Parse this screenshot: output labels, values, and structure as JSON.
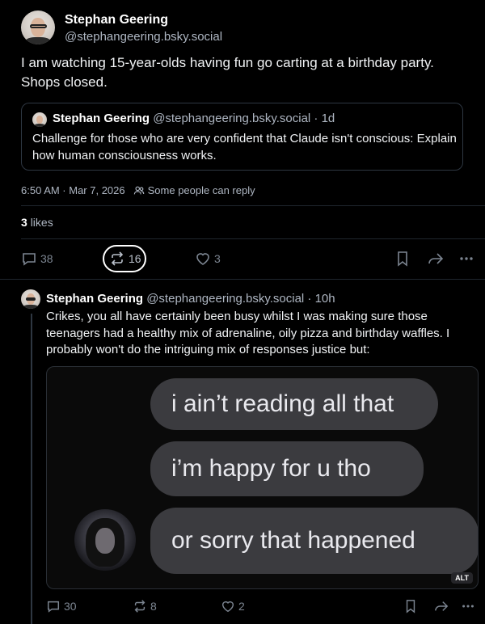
{
  "post": {
    "author_name": "Stephan Geering",
    "author_handle": "@stephangeering.bsky.social",
    "text": "I am watching 15-year-olds having fun go carting at a birthday party. Shops closed.",
    "quote": {
      "author_name": "Stephan Geering",
      "meta": "@stephangeering.bsky.social · 1d",
      "text": "Challenge for those who are very confident that Claude isn't conscious: Explain how human consciousness works."
    },
    "timestamp": "6:50 AM · Mar 7, 2026",
    "reply_setting": "Some people can reply",
    "likes_count": "3",
    "likes_label": "likes",
    "actions": {
      "replies": "38",
      "reposts": "16",
      "likes": "3"
    }
  },
  "reply": {
    "author_name": "Stephan Geering",
    "meta": "@stephangeering.bsky.social · 10h",
    "text": "Crikes, you all have certainly been busy whilst I was making sure those teenagers had a healthy mix of adrenaline, oily pizza and birthday waffles. I probably won't do the intriguing mix of responses justice but:",
    "image": {
      "bubbles": [
        "i ain’t reading all that",
        "i’m happy for u tho",
        "or sorry that happened"
      ],
      "alt_badge": "ALT"
    },
    "actions": {
      "replies": "30",
      "reposts": "8",
      "likes": "2"
    }
  },
  "colors": {
    "background": "#000000",
    "muted_text": "#aeb6c2",
    "icon": "#7c8591",
    "border": "#2e3742"
  }
}
